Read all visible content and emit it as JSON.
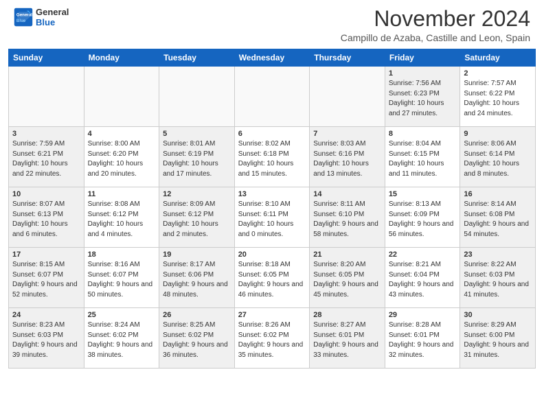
{
  "header": {
    "logo_line1": "General",
    "logo_line2": "Blue",
    "month": "November 2024",
    "location": "Campillo de Azaba, Castille and Leon, Spain"
  },
  "days_of_week": [
    "Sunday",
    "Monday",
    "Tuesday",
    "Wednesday",
    "Thursday",
    "Friday",
    "Saturday"
  ],
  "weeks": [
    [
      {
        "num": "",
        "info": "",
        "empty": true
      },
      {
        "num": "",
        "info": "",
        "empty": true
      },
      {
        "num": "",
        "info": "",
        "empty": true
      },
      {
        "num": "",
        "info": "",
        "empty": true
      },
      {
        "num": "",
        "info": "",
        "empty": true
      },
      {
        "num": "1",
        "info": "Sunrise: 7:56 AM\nSunset: 6:23 PM\nDaylight: 10 hours and 27 minutes.",
        "shaded": true
      },
      {
        "num": "2",
        "info": "Sunrise: 7:57 AM\nSunset: 6:22 PM\nDaylight: 10 hours and 24 minutes.",
        "shaded": false
      }
    ],
    [
      {
        "num": "3",
        "info": "Sunrise: 7:59 AM\nSunset: 6:21 PM\nDaylight: 10 hours and 22 minutes.",
        "shaded": true
      },
      {
        "num": "4",
        "info": "Sunrise: 8:00 AM\nSunset: 6:20 PM\nDaylight: 10 hours and 20 minutes.",
        "shaded": false
      },
      {
        "num": "5",
        "info": "Sunrise: 8:01 AM\nSunset: 6:19 PM\nDaylight: 10 hours and 17 minutes.",
        "shaded": true
      },
      {
        "num": "6",
        "info": "Sunrise: 8:02 AM\nSunset: 6:18 PM\nDaylight: 10 hours and 15 minutes.",
        "shaded": false
      },
      {
        "num": "7",
        "info": "Sunrise: 8:03 AM\nSunset: 6:16 PM\nDaylight: 10 hours and 13 minutes.",
        "shaded": true
      },
      {
        "num": "8",
        "info": "Sunrise: 8:04 AM\nSunset: 6:15 PM\nDaylight: 10 hours and 11 minutes.",
        "shaded": false
      },
      {
        "num": "9",
        "info": "Sunrise: 8:06 AM\nSunset: 6:14 PM\nDaylight: 10 hours and 8 minutes.",
        "shaded": true
      }
    ],
    [
      {
        "num": "10",
        "info": "Sunrise: 8:07 AM\nSunset: 6:13 PM\nDaylight: 10 hours and 6 minutes.",
        "shaded": true
      },
      {
        "num": "11",
        "info": "Sunrise: 8:08 AM\nSunset: 6:12 PM\nDaylight: 10 hours and 4 minutes.",
        "shaded": false
      },
      {
        "num": "12",
        "info": "Sunrise: 8:09 AM\nSunset: 6:12 PM\nDaylight: 10 hours and 2 minutes.",
        "shaded": true
      },
      {
        "num": "13",
        "info": "Sunrise: 8:10 AM\nSunset: 6:11 PM\nDaylight: 10 hours and 0 minutes.",
        "shaded": false
      },
      {
        "num": "14",
        "info": "Sunrise: 8:11 AM\nSunset: 6:10 PM\nDaylight: 9 hours and 58 minutes.",
        "shaded": true
      },
      {
        "num": "15",
        "info": "Sunrise: 8:13 AM\nSunset: 6:09 PM\nDaylight: 9 hours and 56 minutes.",
        "shaded": false
      },
      {
        "num": "16",
        "info": "Sunrise: 8:14 AM\nSunset: 6:08 PM\nDaylight: 9 hours and 54 minutes.",
        "shaded": true
      }
    ],
    [
      {
        "num": "17",
        "info": "Sunrise: 8:15 AM\nSunset: 6:07 PM\nDaylight: 9 hours and 52 minutes.",
        "shaded": true
      },
      {
        "num": "18",
        "info": "Sunrise: 8:16 AM\nSunset: 6:07 PM\nDaylight: 9 hours and 50 minutes.",
        "shaded": false
      },
      {
        "num": "19",
        "info": "Sunrise: 8:17 AM\nSunset: 6:06 PM\nDaylight: 9 hours and 48 minutes.",
        "shaded": true
      },
      {
        "num": "20",
        "info": "Sunrise: 8:18 AM\nSunset: 6:05 PM\nDaylight: 9 hours and 46 minutes.",
        "shaded": false
      },
      {
        "num": "21",
        "info": "Sunrise: 8:20 AM\nSunset: 6:05 PM\nDaylight: 9 hours and 45 minutes.",
        "shaded": true
      },
      {
        "num": "22",
        "info": "Sunrise: 8:21 AM\nSunset: 6:04 PM\nDaylight: 9 hours and 43 minutes.",
        "shaded": false
      },
      {
        "num": "23",
        "info": "Sunrise: 8:22 AM\nSunset: 6:03 PM\nDaylight: 9 hours and 41 minutes.",
        "shaded": true
      }
    ],
    [
      {
        "num": "24",
        "info": "Sunrise: 8:23 AM\nSunset: 6:03 PM\nDaylight: 9 hours and 39 minutes.",
        "shaded": true
      },
      {
        "num": "25",
        "info": "Sunrise: 8:24 AM\nSunset: 6:02 PM\nDaylight: 9 hours and 38 minutes.",
        "shaded": false
      },
      {
        "num": "26",
        "info": "Sunrise: 8:25 AM\nSunset: 6:02 PM\nDaylight: 9 hours and 36 minutes.",
        "shaded": true
      },
      {
        "num": "27",
        "info": "Sunrise: 8:26 AM\nSunset: 6:02 PM\nDaylight: 9 hours and 35 minutes.",
        "shaded": false
      },
      {
        "num": "28",
        "info": "Sunrise: 8:27 AM\nSunset: 6:01 PM\nDaylight: 9 hours and 33 minutes.",
        "shaded": true
      },
      {
        "num": "29",
        "info": "Sunrise: 8:28 AM\nSunset: 6:01 PM\nDaylight: 9 hours and 32 minutes.",
        "shaded": false
      },
      {
        "num": "30",
        "info": "Sunrise: 8:29 AM\nSunset: 6:00 PM\nDaylight: 9 hours and 31 minutes.",
        "shaded": true
      }
    ]
  ]
}
